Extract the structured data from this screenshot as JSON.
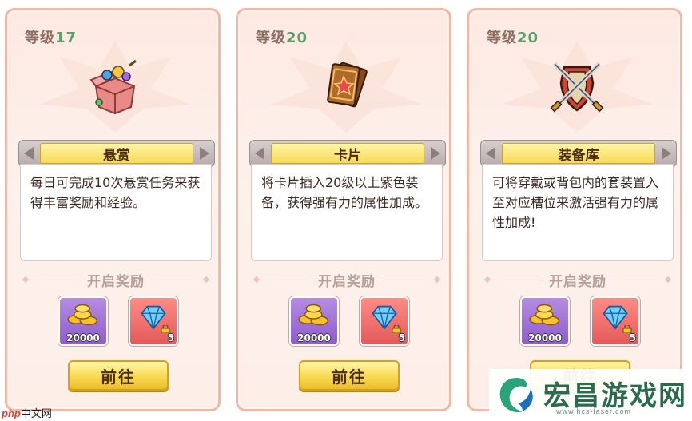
{
  "cards": [
    {
      "level_label": "等级",
      "level_value": "17",
      "icon": "bounty-chest-icon",
      "title": "悬赏",
      "description": "每日可完成10次悬赏任务来获得丰富奖励和经验。",
      "reward_header": "开启奖励",
      "rewards": [
        {
          "icon": "gold-coins-icon",
          "qty": "20000"
        },
        {
          "icon": "diamond-icon",
          "qty": "5",
          "locked": true
        }
      ],
      "button_label": "前往"
    },
    {
      "level_label": "等级",
      "level_value": "20",
      "icon": "card-deck-icon",
      "title": "卡片",
      "description": "将卡片插入20级以上紫色装备，获得强有力的属性加成。",
      "reward_header": "开启奖励",
      "rewards": [
        {
          "icon": "gold-coins-icon",
          "qty": "20000"
        },
        {
          "icon": "diamond-icon",
          "qty": "5",
          "locked": true
        }
      ],
      "button_label": "前往"
    },
    {
      "level_label": "等级",
      "level_value": "20",
      "icon": "crossed-swords-shield-icon",
      "title": "装备库",
      "description": "可将穿戴或背包内的套装置入至对应槽位来激活强有力的属性加成!",
      "reward_header": "开启奖励",
      "rewards": [
        {
          "icon": "gold-coins-icon",
          "qty": "20000"
        },
        {
          "icon": "diamond-icon",
          "qty": "5",
          "locked": true
        }
      ],
      "button_label": "前往"
    }
  ],
  "watermarks": {
    "php_logo_text": "php",
    "php_site_text": "中文网",
    "site_name": "宏昌游戏网",
    "site_url": "www.hcs-laser.com"
  },
  "colors": {
    "card_border": "#f2b8a5",
    "level_number": "#5f9d6b",
    "title_banner": "#f7da55",
    "go_button": "#f9d952",
    "gold_reward_bg": "#8e5ccc",
    "gem_reward_bg": "#e25a5a"
  }
}
